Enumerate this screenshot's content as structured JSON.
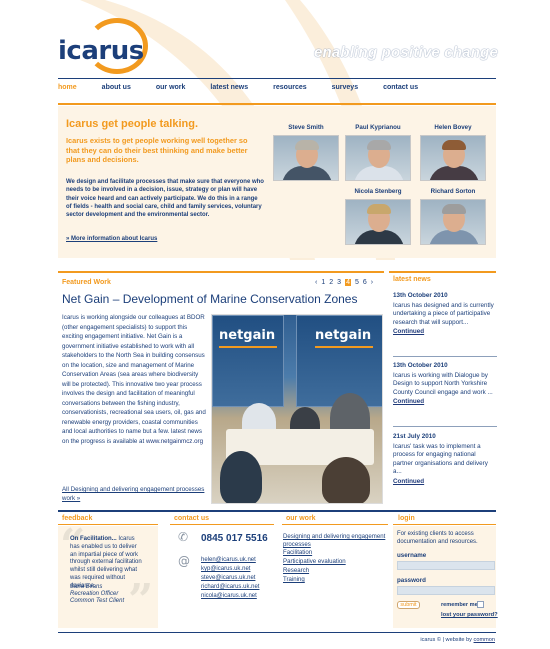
{
  "brand": {
    "logo_text": "icarus",
    "tagline": "enabling positive change"
  },
  "nav": [
    "home",
    "about us",
    "our work",
    "latest news",
    "resources",
    "surveys",
    "contact us"
  ],
  "hero": {
    "title": "Icarus get people talking.",
    "lead": "Icarus exists to get people working well together so that they can do their best thinking and make better plans and decisions.",
    "body": "We design and facilitate processes that make sure that everyone who needs to be involved in a decision, issue, strategy or plan will have their voice heard and can actively participate. We do this in a range of fields - health and social care, child and family services, voluntary sector development and the environmental sector.",
    "more_link": "» More information about Icarus"
  },
  "team": [
    "Steve Smith",
    "Paul Kyprianou",
    "Helen Bovey",
    "Nicola Stenberg",
    "Richard Sorton"
  ],
  "featured": {
    "label": "Featured Work",
    "pager": {
      "prev": "‹",
      "pages": [
        "1",
        "2",
        "3",
        "4",
        "5",
        "6"
      ],
      "current": "4",
      "next": "›"
    },
    "title": "Net Gain – Development of Marine Conservation Zones",
    "body": "Icarus is working alongside our colleagues at BDOR (other engagement specialists) to support this exciting engagement initiative. Net Gain is a government initiative established to work with all stakeholders to the North Sea in building consensus on the location, size and management of Marine Conservation Areas (sea areas where biodiversity will be protected). This innovative two year process involves the design and facilitation of meaningful conversations between the fishing industry, conservationists, recreational sea users, oil, gas and renewable energy providers, coastal communities and local authorities to name but a few. latest news on the progress is available at",
    "url": "www.netgainmcz.org",
    "all_link": "All Designing and delivering engagement processes work »",
    "banner_logo": "netgain"
  },
  "news": {
    "label": "latest news",
    "continued": "Continued",
    "items": [
      {
        "date": "13th October 2010",
        "text": "Icarus has designed and is currently undertaking a piece of participative research that will support..."
      },
      {
        "date": "13th October 2010",
        "text": "Icarus is working with Dialogue by Design to support North Yorkshire County Council engage and work ..."
      },
      {
        "date": "21st July 2010",
        "text": "Icarus' task was to implement a process for engaging national partner organisations and delivery a..."
      }
    ]
  },
  "feedback": {
    "label": "feedback",
    "quote_title": "On Facilitation...",
    "quote": "Icarus has enabled us to deliver an impartial piece of work through external facilitation whilst still delivering what was required without deviance.",
    "name": "Saira Evans",
    "role": "Recreation Officer",
    "org": "Common Test Client"
  },
  "contact": {
    "label": "contact us",
    "phone": "0845 017 5516",
    "emails": [
      "helen@icarus.uk.net",
      "kyp@icarus.uk.net",
      "steve@icarus.uk.net",
      "richard@icarus.uk.net",
      "nicola@icarus.uk.net"
    ]
  },
  "work": {
    "label": "our work",
    "links": [
      "Designing and delivering engagement processes",
      "Facilitation",
      "Participative evaluation",
      "Research",
      "Training"
    ]
  },
  "login": {
    "label": "login",
    "intro": "For existing clients to access documentation and resources.",
    "username_label": "username",
    "password_label": "password",
    "submit_label": "submit",
    "remember_label": "remember me",
    "lost_password": "lost your password?"
  },
  "footer": {
    "copyright": "icarus ©",
    "website_prefix": "website by",
    "website_by": "common"
  },
  "colors": {
    "brand_navy": "#1c3f7a",
    "accent_orange": "#f29a1f",
    "panel_cream": "#fdf4e6"
  }
}
